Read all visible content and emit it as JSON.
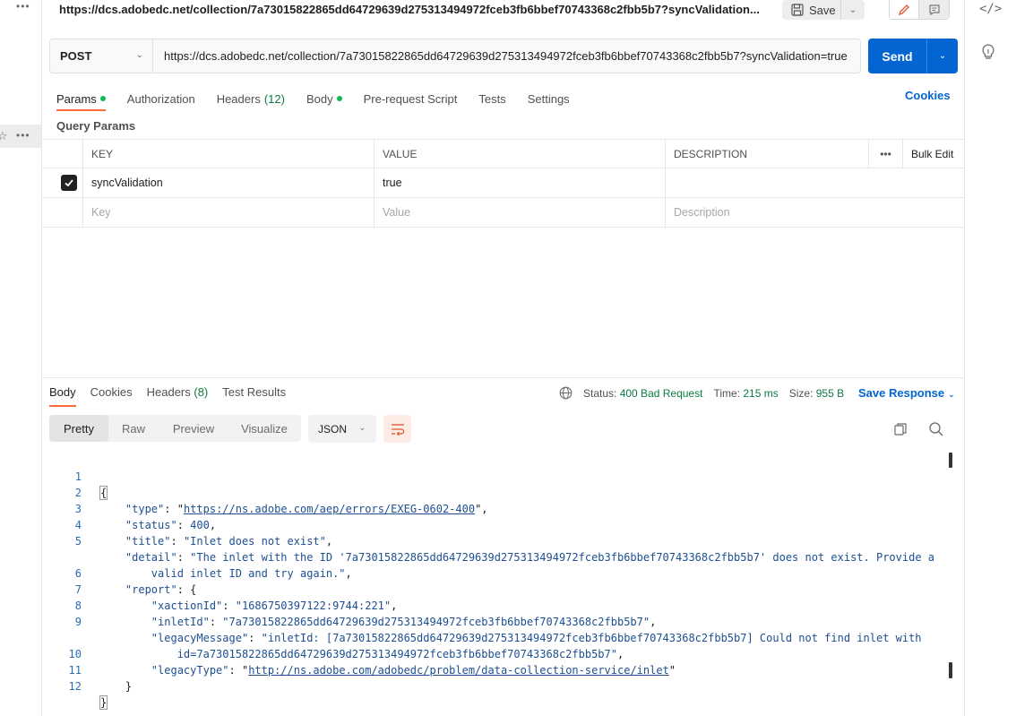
{
  "window": {
    "title": "https://dcs.adobedc.net/collection/7a73015822865dd64729639d275313494972fceb3fb6bbef70743368c2fbb5b7?syncValidation...",
    "save_label": "Save"
  },
  "request": {
    "method": "POST",
    "url": "https://dcs.adobedc.net/collection/7a73015822865dd64729639d275313494972fceb3fb6bbef70743368c2fbb5b7?syncValidation=true",
    "send_label": "Send",
    "tabs": [
      {
        "label": "Params"
      },
      {
        "label": "Authorization"
      },
      {
        "label": "Headers",
        "count": "(12)"
      },
      {
        "label": "Body"
      },
      {
        "label": "Pre-request Script"
      },
      {
        "label": "Tests"
      },
      {
        "label": "Settings"
      }
    ],
    "cookies_label": "Cookies"
  },
  "query_params": {
    "title": "Query Params",
    "headers": {
      "key": "KEY",
      "value": "VALUE",
      "description": "DESCRIPTION",
      "more": "•••",
      "bulk_edit": "Bulk Edit"
    },
    "rows": [
      {
        "key": "syncValidation",
        "value": "true",
        "description": "",
        "checked": true
      }
    ],
    "placeholders": {
      "key": "Key",
      "value": "Value",
      "description": "Description"
    }
  },
  "response": {
    "tabs": [
      {
        "label": "Body"
      },
      {
        "label": "Cookies"
      },
      {
        "label": "Headers",
        "count": "(8)"
      },
      {
        "label": "Test Results"
      }
    ],
    "status_label": "Status:",
    "status_value": "400 Bad Request",
    "time_label": "Time:",
    "time_value": "215 ms",
    "size_label": "Size:",
    "size_value": "955 B",
    "save_response_label": "Save Response",
    "view_tabs": [
      "Pretty",
      "Raw",
      "Preview",
      "Visualize"
    ],
    "format": "JSON",
    "code_lines": [
      {
        "num": "1"
      },
      {
        "num": "2"
      },
      {
        "num": "3"
      },
      {
        "num": "4"
      },
      {
        "num": "5"
      },
      {
        "num": ""
      },
      {
        "num": "6"
      },
      {
        "num": "7"
      },
      {
        "num": "8"
      },
      {
        "num": "9"
      },
      {
        "num": ""
      },
      {
        "num": "10"
      },
      {
        "num": "11"
      },
      {
        "num": "12"
      }
    ],
    "json": {
      "type_key": "\"type\"",
      "type_val": "https://ns.adobe.com/aep/errors/EXEG-0602-400",
      "status_key": "\"status\"",
      "status_val": "400",
      "title_key": "\"title\"",
      "title_val": "\"Inlet does not exist\"",
      "detail_key": "\"detail\"",
      "detail_val_1": "\"The inlet with the ID '7a73015822865dd64729639d275313494972fceb3fb6bbef70743368c2fbb5b7' does not exist. Provide a",
      "detail_val_2": "valid inlet ID and try again.\"",
      "report_key": "\"report\"",
      "xaction_key": "\"xactionId\"",
      "xaction_val": "\"1686750397122:9744:221\"",
      "inlet_key": "\"inletId\"",
      "inlet_val": "\"7a73015822865dd64729639d275313494972fceb3fb6bbef70743368c2fbb5b7\"",
      "legacy_msg_key": "\"legacyMessage\"",
      "legacy_msg_val_1": "\"inletId: [7a73015822865dd64729639d275313494972fceb3fb6bbef70743368c2fbb5b7] Could not find inlet with",
      "legacy_msg_val_2": "id=7a73015822865dd64729639d275313494972fceb3fb6bbef70743368c2fbb5b7\"",
      "legacy_type_key": "\"legacyType\"",
      "legacy_type_val": "http://ns.adobe.com/adobedc/problem/data-collection-service/inlet"
    }
  },
  "colors": {
    "accent": "#ff6c37",
    "primary": "#0265d2",
    "success": "#0cbb52"
  }
}
